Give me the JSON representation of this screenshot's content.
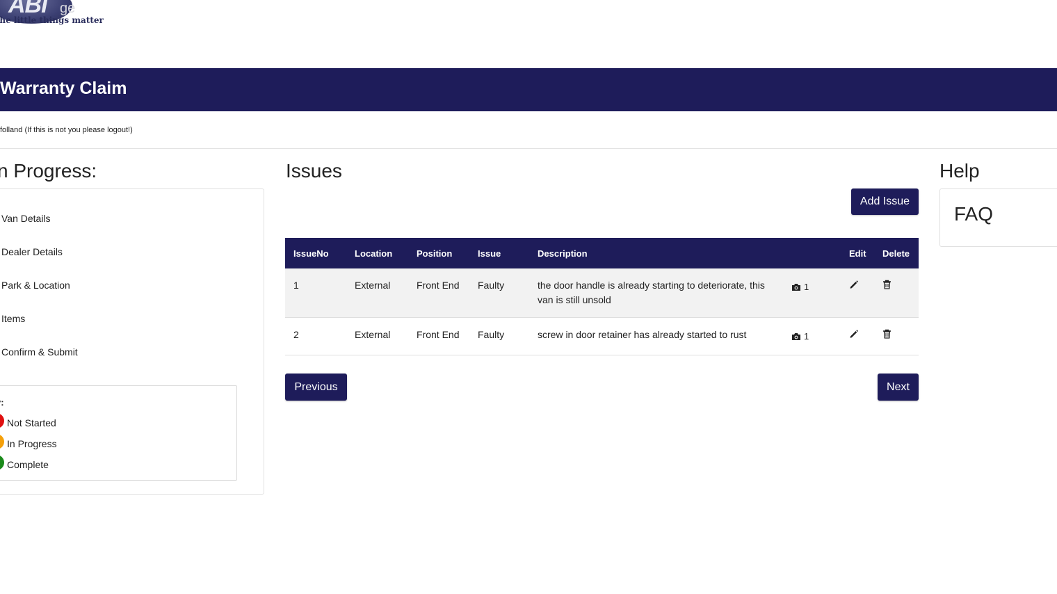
{
  "logo": {
    "mark": "ABI",
    "ghost_text": "ge",
    "tagline": "e the little things matter"
  },
  "header": {
    "title": "Warranty Claim"
  },
  "user_line": "folland (If this is not you please logout!)",
  "progress": {
    "title": "n Progress:",
    "steps": [
      "Van Details",
      "Dealer Details",
      "Park & Location",
      "Items",
      "Confirm & Submit"
    ],
    "key": {
      "title": "y:",
      "items": [
        {
          "label": "Not Started",
          "color": "#e01010"
        },
        {
          "label": "In Progress",
          "color": "#f5a00a"
        },
        {
          "label": "Complete",
          "color": "#1a8a1a"
        }
      ]
    }
  },
  "issues": {
    "title": "Issues",
    "add_label": "Add Issue",
    "columns": [
      "IssueNo",
      "Location",
      "Position",
      "Issue",
      "Description",
      "",
      "Edit",
      "Delete"
    ],
    "rows": [
      {
        "no": "1",
        "location": "External",
        "position": "Front End",
        "issue": "Faulty",
        "description": "the door handle is already starting to deteriorate, this van is still unsold",
        "photos": "1"
      },
      {
        "no": "2",
        "location": "External",
        "position": "Front End",
        "issue": "Faulty",
        "description": "screw in door retainer has already started to rust",
        "photos": "1"
      }
    ],
    "previous_label": "Previous",
    "next_label": "Next"
  },
  "help": {
    "title": "Help",
    "faq": "FAQ"
  },
  "colors": {
    "brand": "#1e1c5a"
  }
}
